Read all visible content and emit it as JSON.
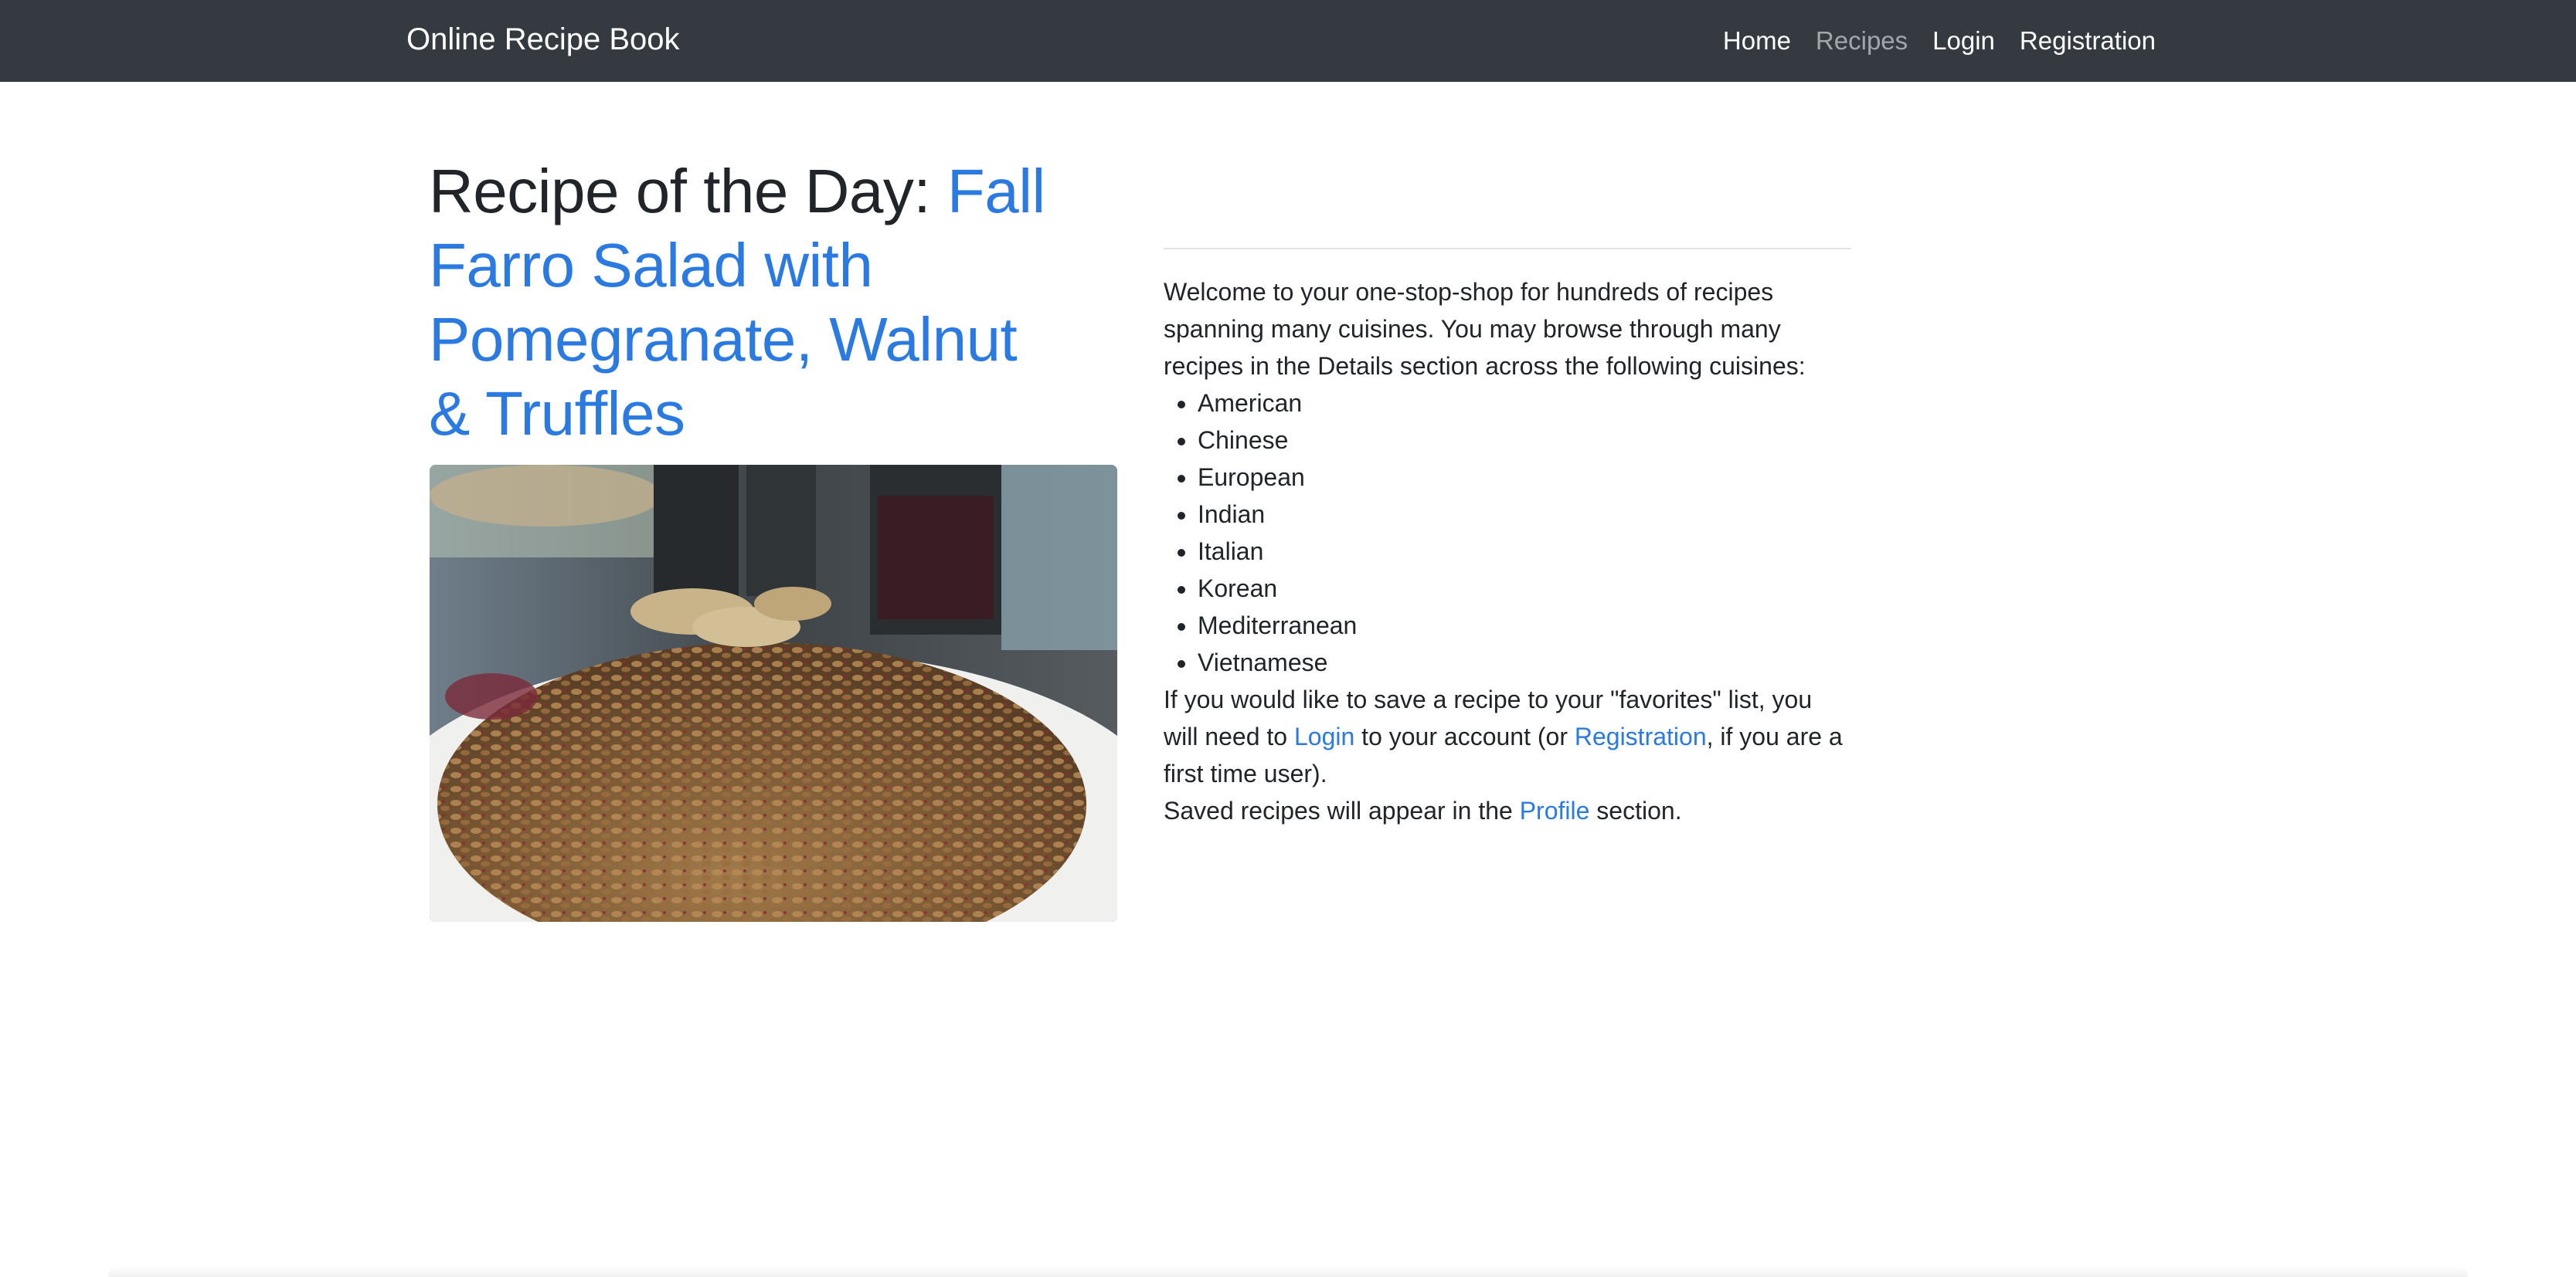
{
  "navbar": {
    "brand": "Online Recipe Book",
    "links": [
      {
        "label": "Home",
        "active": false
      },
      {
        "label": "Recipes",
        "active": true
      },
      {
        "label": "Login",
        "active": false
      },
      {
        "label": "Registration",
        "active": false
      }
    ]
  },
  "recipe_of_day": {
    "prefix": "Recipe of the Day: ",
    "name": "Fall Farro Salad with Pomegranate, Walnut & Truffles"
  },
  "intro": {
    "welcome": "Welcome to your one-stop-shop for hundreds of recipes spanning many cuisines. You may browse through many recipes in the Details section across the following cuisines:",
    "cuisines": [
      "American",
      "Chinese",
      "European",
      "Indian",
      "Italian",
      "Korean",
      "Mediterranean",
      "Vietnamese"
    ],
    "favorites_part1": "If you would like to save a recipe to your \"favorites\" list, you will need to ",
    "login_link": "Login",
    "favorites_part2": " to your account (or ",
    "registration_link": "Registration",
    "favorites_part3": ", if you are a first time user).",
    "saved_part1": "Saved recipes will appear in the ",
    "profile_link": "Profile",
    "saved_part2": " section."
  },
  "colors": {
    "navbar_bg": "#343a40",
    "link": "#2a7ae2",
    "text": "#212529"
  }
}
